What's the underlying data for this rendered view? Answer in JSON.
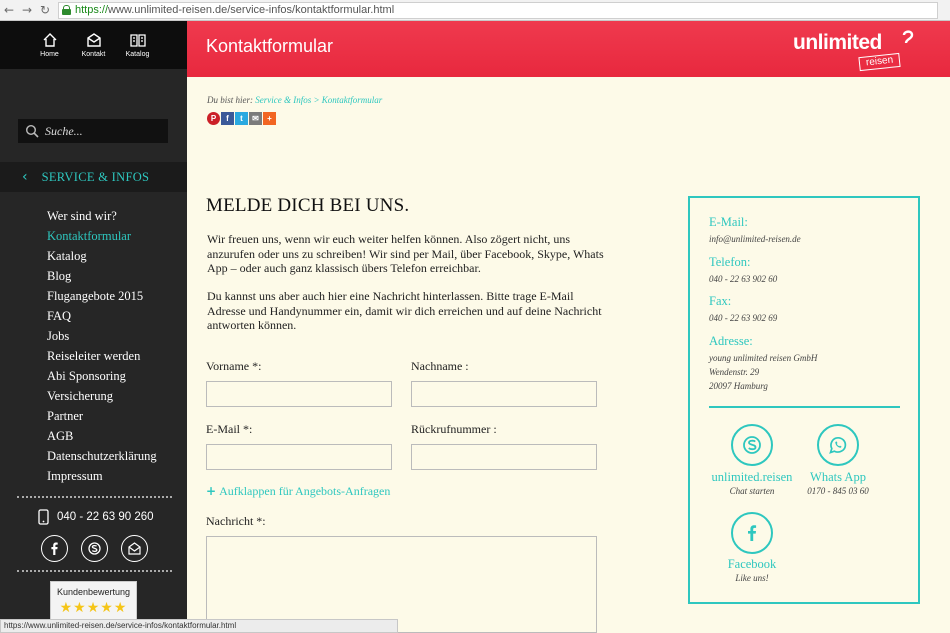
{
  "browser": {
    "url_https": "https://",
    "url_rest": "www.unlimited-reisen.de/service-infos/kontaktformular.html"
  },
  "sidebar": {
    "top_nav": [
      {
        "label": "Home",
        "icon": "home-icon"
      },
      {
        "label": "Kontakt",
        "icon": "mail-icon"
      },
      {
        "label": "Katalog",
        "icon": "book-icon"
      }
    ],
    "search_placeholder": "Suche...",
    "section_title": "SERVICE & INFOS",
    "menu": [
      {
        "label": "Wer sind wir?",
        "active": false
      },
      {
        "label": "Kontaktformular",
        "active": true
      },
      {
        "label": "Katalog",
        "active": false
      },
      {
        "label": "Blog",
        "active": false
      },
      {
        "label": "Flugangebote 2015",
        "active": false
      },
      {
        "label": "FAQ",
        "active": false
      },
      {
        "label": "Jobs",
        "active": false
      },
      {
        "label": "Reiseleiter werden",
        "active": false
      },
      {
        "label": "Abi Sponsoring",
        "active": false
      },
      {
        "label": "Versicherung",
        "active": false
      },
      {
        "label": "Partner",
        "active": false
      },
      {
        "label": "AGB",
        "active": false
      },
      {
        "label": "Datenschutzerklärung",
        "active": false
      },
      {
        "label": "Impressum",
        "active": false
      }
    ],
    "phone": "040 - 22 63 90 260",
    "social": [
      "facebook-icon",
      "skype-icon",
      "envelope-icon"
    ],
    "rating_label": "Kundenbewertung",
    "rating_stars": 5
  },
  "header": {
    "title": "Kontaktformular",
    "logo_word": "unlimited",
    "logo_sub": "reisen"
  },
  "main": {
    "breadcrumb_prefix": "Du bist hier:",
    "breadcrumb_links": "Service & Infos > Kontaktformular",
    "share_icons": [
      {
        "name": "pinterest-icon",
        "glyph": "P",
        "color": "#cb2027"
      },
      {
        "name": "facebook-share-icon",
        "glyph": "f",
        "color": "#3b5998"
      },
      {
        "name": "twitter-share-icon",
        "glyph": "t",
        "color": "#2aa9e0"
      },
      {
        "name": "email-share-icon",
        "glyph": "✉",
        "color": "#7b7b7b"
      },
      {
        "name": "more-share-icon",
        "glyph": "+",
        "color": "#f26522"
      }
    ],
    "heading": "MELDE DICH BEI UNS.",
    "para1": "Wir freuen uns, wenn wir euch weiter helfen können. Also zögert nicht, uns anzurufen oder uns zu schreiben! Wir sind per Mail, über Facebook, Skype, Whats App – oder auch ganz klassisch übers Telefon erreichbar.",
    "para2": "Du kannst uns aber auch hier eine Nachricht hinterlassen. Bitte trage E-Mail Adresse und Handynummer ein, damit wir dich erreichen und auf deine Nachricht antworten können.",
    "form": {
      "vorname_label": "Vorname *:",
      "nachname_label": "Nachname :",
      "email_label": "E-Mail *:",
      "rueckruf_label": "Rückrufnummer :",
      "expand_label": "Aufklappen für Angebots-Anfragen",
      "nachricht_label": "Nachricht *:"
    }
  },
  "contact": {
    "email_label": "E-Mail:",
    "email_value": "info@unlimited-reisen.de",
    "telefon_label": "Telefon:",
    "telefon_value": "040 - 22 63 902 60",
    "fax_label": "Fax:",
    "fax_value": "040 - 22 63 902 69",
    "adresse_label": "Adresse:",
    "adresse_line1": "young unlimited reisen GmbH",
    "adresse_line2": "Wendenstr. 29",
    "adresse_line3": "20097 Hamburg",
    "skype_name": "unlimited.reisen",
    "skype_sub": "Chat starten",
    "whatsapp_name": "Whats App",
    "whatsapp_sub": "0170 - 845 03 60",
    "facebook_name": "Facebook",
    "facebook_sub": "Like uns!"
  },
  "statusbar": {
    "text": "https://www.unlimited-reisen.de/service-infos/kontaktformular.html"
  },
  "colors": {
    "accent": "#2ec7bf",
    "header_red": "#ea2d42",
    "sidebar_dark": "#262626",
    "page_bg": "#fdfae8"
  }
}
